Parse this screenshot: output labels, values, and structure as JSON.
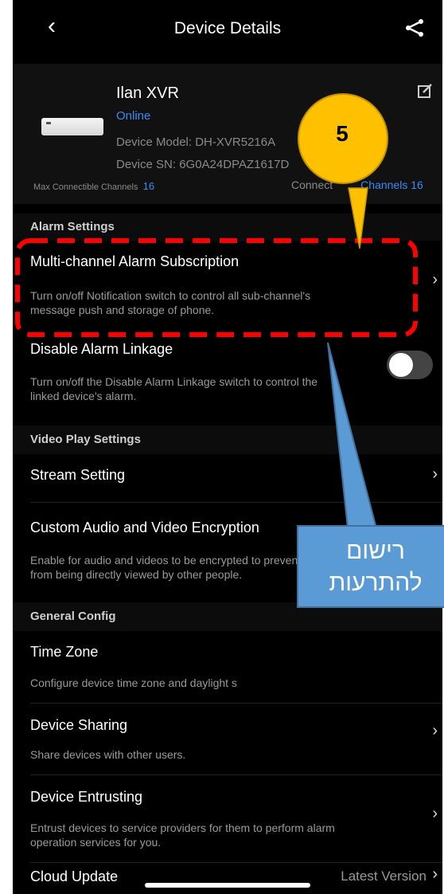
{
  "header": {
    "title": "Device Details"
  },
  "device": {
    "name": "Ilan XVR",
    "status": "Online",
    "model_label": "Device Model:",
    "model_value": "DH-XVR5216A",
    "sn_label": "Device SN:",
    "sn_value": "6G0A24DPAZ1617D",
    "max_channels_label": "Max Connectible Channels",
    "max_channels_value": "16",
    "connected_label": "Connect",
    "connected_label_tail": "Channels",
    "connected_value": "16"
  },
  "sections": {
    "alarm": "Alarm Settings",
    "video": "Video Play Settings",
    "general": "General Config"
  },
  "rows": {
    "multi_alarm": {
      "title": "Multi-channel Alarm Subscription",
      "desc": "Turn on/off Notification switch to control all sub-channel's message push and storage of phone."
    },
    "disable_linkage": {
      "title": "Disable Alarm Linkage",
      "desc": "Turn on/off the Disable Alarm Linkage switch to control the linked device's alarm."
    },
    "stream": {
      "title": "Stream Setting"
    },
    "encryption": {
      "title": "Custom Audio and Video Encryption",
      "desc": "Enable for audio and videos to be encrypted to prevent them from being directly viewed by other people."
    },
    "timezone": {
      "title": "Time Zone",
      "desc": "Configure device time zone and daylight s"
    },
    "sharing": {
      "title": "Device Sharing",
      "desc": "Share devices with other users."
    },
    "entrusting": {
      "title": "Device Entrusting",
      "desc": "Entrust devices to service providers for them to perform alarm operation services for you."
    },
    "cloud": {
      "title": "Cloud Update",
      "value": "Latest Version"
    }
  },
  "annotation": {
    "badge_number": "5",
    "callout_line1": "רישום",
    "callout_line2": "להתרעות",
    "callout_color": "#5b9bd5",
    "badge_color": "#ffc000",
    "highlight_color": "#ff0000"
  },
  "toggle": {
    "disable_alarm_linkage_on": false
  }
}
